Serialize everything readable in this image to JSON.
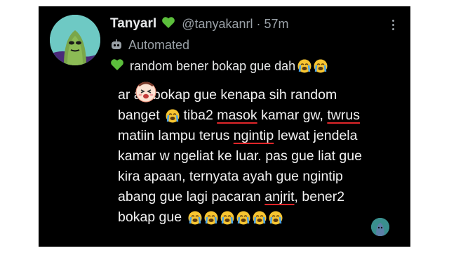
{
  "tweet": {
    "author_name": "TanyarI",
    "author_handle": "@tanyakanrl",
    "separator": "·",
    "time": "57m",
    "automated_label": "Automated",
    "headline": "random bener bokap gue dah",
    "body_lines": [
      "ar ah bokap gue kenapa sih random",
      "banget",
      "tiba2",
      "masok",
      "kamar gw,",
      "twrus",
      "matiin lampu terus",
      "ngintip",
      "lewat jendela",
      "kamar w ngeliat ke luar. pas gue liat gue",
      "kira apaan, ternyata ayah gue ngintip",
      "abang gue lagi pacaran",
      "anjrit",
      ", bener2",
      "bokap gue"
    ],
    "colors": {
      "background": "#000000",
      "text": "#e7e9ea",
      "secondary": "#9aa1a7",
      "heart": "#5cbf3c",
      "underline": "#e0262a"
    }
  },
  "icons": {
    "heart": "green-heart-icon",
    "bot": "robot-icon",
    "more": "more-options-icon",
    "cry": "crying-face-icon"
  }
}
